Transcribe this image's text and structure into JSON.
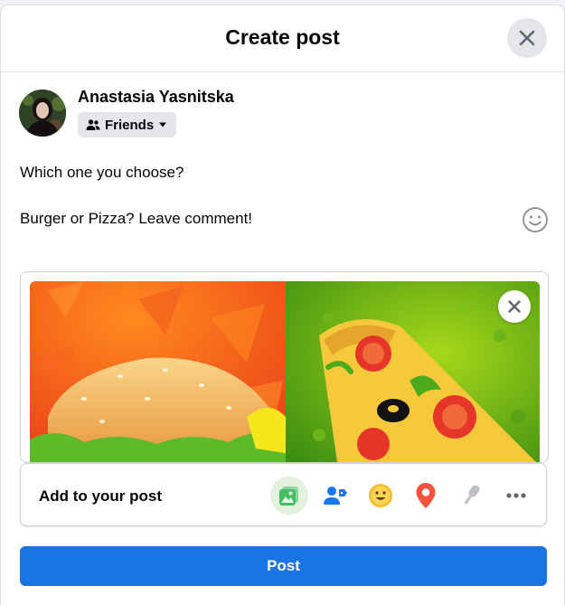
{
  "dialog": {
    "title": "Create post",
    "close_icon": "close-icon"
  },
  "author": {
    "name": "Anastasia Yasnitska",
    "audience_label": "Friends",
    "audience_icon": "friends-icon",
    "audience_caret_icon": "caret-down-icon"
  },
  "composer": {
    "line1": "Which one you choose?",
    "line2": "Burger or Pizza? Leave comment!",
    "emoji_icon": "smiley-icon"
  },
  "attachment": {
    "description": "burger-and-pizza-illustration",
    "remove_icon": "close-icon"
  },
  "add_to_post": {
    "label": "Add to your post",
    "items": [
      {
        "name": "photo-video",
        "icon": "photo-icon",
        "color": "#45bd62"
      },
      {
        "name": "tag-people",
        "icon": "tag-people-icon",
        "color": "#1877f2"
      },
      {
        "name": "feeling-activity",
        "icon": "feeling-icon",
        "color": "#f7b928"
      },
      {
        "name": "check-in",
        "icon": "location-icon",
        "color": "#f5533d"
      },
      {
        "name": "live-audio",
        "icon": "microphone-icon",
        "color": "#bcc0c4"
      },
      {
        "name": "more",
        "icon": "more-icon",
        "color": "#65676b"
      }
    ]
  },
  "post_button": {
    "label": "Post",
    "color": "#1b74e4"
  }
}
